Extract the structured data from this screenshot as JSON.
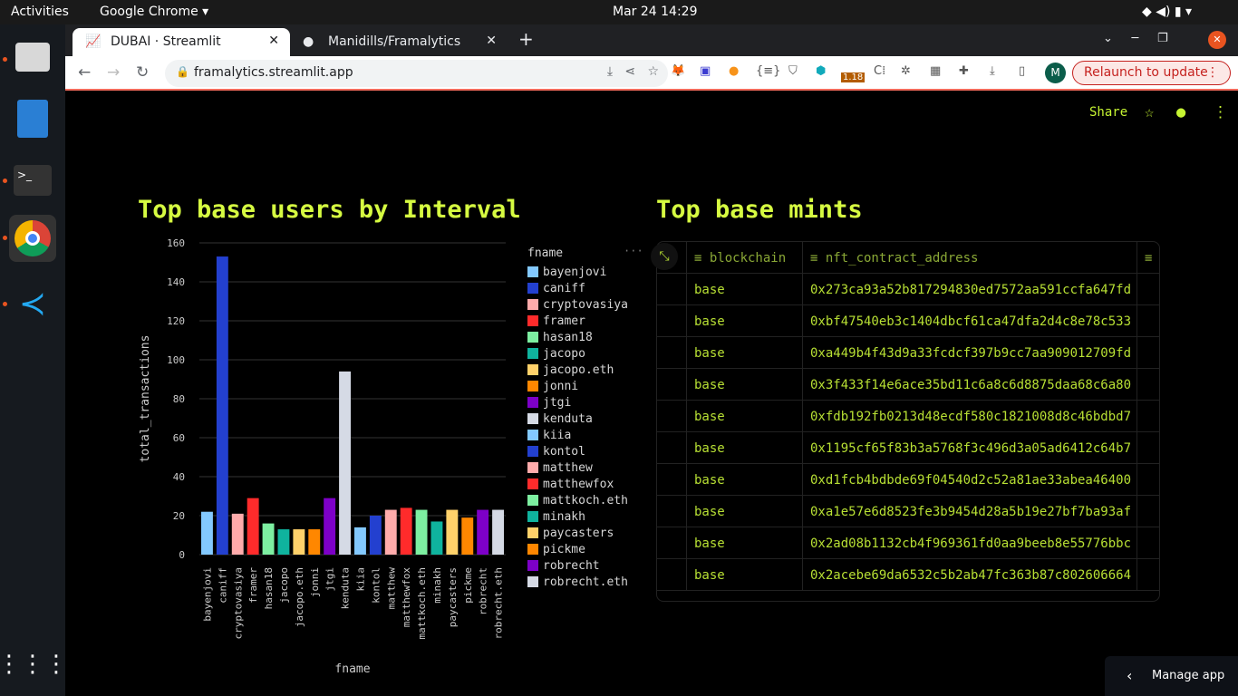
{
  "topbar": {
    "activities": "Activities",
    "app": "Google Chrome ▾",
    "datetime": "Mar 24  14:29"
  },
  "browser": {
    "tabs": [
      {
        "label": "DUBAI · Streamlit",
        "active": true
      },
      {
        "label": "Manidills/Framalytics",
        "active": false
      }
    ],
    "url": "framalytics.streamlit.app",
    "ext_badge": "1.18",
    "avatar": "M",
    "relaunch": "Relaunch to update"
  },
  "app_header": {
    "share": "Share"
  },
  "chart": {
    "title": "Top base users by Interval",
    "legend_title": "fname"
  },
  "chart_data": {
    "type": "bar",
    "xlabel": "fname",
    "ylabel": "total_transactions",
    "ylim": [
      0,
      160
    ],
    "yticks": [
      0,
      20,
      40,
      60,
      80,
      100,
      120,
      140,
      160
    ],
    "grid": true,
    "legend": "right",
    "categories": [
      "bayenjovi",
      "caniff",
      "cryptovasiya",
      "framer",
      "hasan18",
      "jacopo",
      "jacopo.eth",
      "jonni",
      "jtgi",
      "kenduta",
      "kiia",
      "kontol",
      "matthew",
      "matthewfox",
      "mattkoch.eth",
      "minakh",
      "paycasters",
      "pickme",
      "robrecht",
      "robrecht.eth"
    ],
    "values": [
      22,
      153,
      21,
      29,
      16,
      13,
      13,
      13,
      29,
      94,
      14,
      20,
      23,
      24,
      23,
      17,
      23,
      19,
      23,
      23
    ],
    "colors": [
      "#83c9ff",
      "#2340cf",
      "#ffabab",
      "#ff2b2b",
      "#7defa1",
      "#0fb39e",
      "#ffd16a",
      "#ff8700",
      "#7d00c8",
      "#d5dae5",
      "#83c9ff",
      "#2340cf",
      "#ffabab",
      "#ff2b2b",
      "#7defa1",
      "#0fb39e",
      "#ffd16a",
      "#ff8700",
      "#7d00c8",
      "#d5dae5"
    ]
  },
  "mints": {
    "title": "Top base mints",
    "columns": [
      "blockchain",
      "nft_contract_address"
    ],
    "rows": [
      [
        "base",
        "0x273ca93a52b817294830ed7572aa591ccfa647fd"
      ],
      [
        "base",
        "0xbf47540eb3c1404dbcf61ca47dfa2d4c8e78c533"
      ],
      [
        "base",
        "0xa449b4f43d9a33fcdcf397b9cc7aa909012709fd"
      ],
      [
        "base",
        "0x3f433f14e6ace35bd11c6a8c6d8875daa68c6a80"
      ],
      [
        "base",
        "0xfdb192fb0213d48ecdf580c1821008d8c46bdbd7"
      ],
      [
        "base",
        "0x1195cf65f83b3a5768f3c496d3a05ad6412c64b7"
      ],
      [
        "base",
        "0xd1fcb4bdbde69f04540d2c52a81ae33abea46400"
      ],
      [
        "base",
        "0xa1e57e6d8523fe3b9454d28a5b19e27bf7ba93af"
      ],
      [
        "base",
        "0x2ad08b1132cb4f969361fd0aa9beeb8e55776bbc"
      ],
      [
        "base",
        "0x2acebe69da6532c5b2ab47fc363b87c802606664"
      ]
    ]
  },
  "manage_app": "Manage app"
}
